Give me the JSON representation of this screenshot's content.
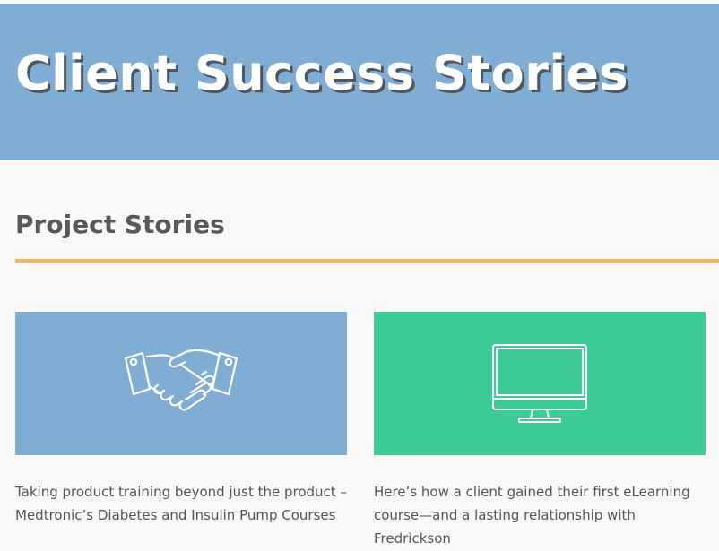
{
  "hero": {
    "title": "Client Success Stories",
    "background_color": "#80add3"
  },
  "section": {
    "title": "Project Stories",
    "divider_color": "#f2b65f"
  },
  "cards": [
    {
      "icon": "handshake-icon",
      "background_color": "#80add3",
      "text": "Taking product training beyond just the product – Medtronic’s Diabetes and Insulin Pump Courses"
    },
    {
      "icon": "monitor-icon",
      "background_color": "#3ecc96",
      "text": "Here’s how a client gained their first eLearning course—and a lasting relationship with Fredrickson"
    }
  ]
}
